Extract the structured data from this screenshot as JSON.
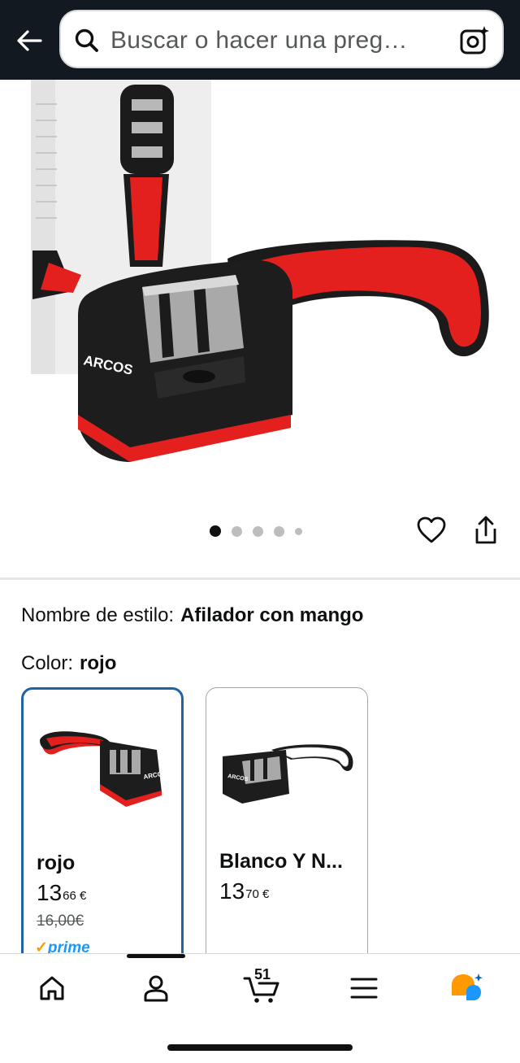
{
  "search": {
    "placeholder": "Buscar o hacer una preg…"
  },
  "product": {
    "brand_mark": "ARCOS",
    "image_index": 1,
    "image_count": 5
  },
  "selections": {
    "style_label": "Nombre de estilo:",
    "style_value": "Afilador con mango",
    "color_label": "Color:",
    "color_value": "rojo"
  },
  "swatches": [
    {
      "name": "rojo",
      "price_whole": "13",
      "price_frac": "66 €",
      "old_price": "16,00€",
      "prime": "prime",
      "selected": true,
      "accent": "#d71f1f"
    },
    {
      "name": "Blanco Y N...",
      "price_whole": "13",
      "price_frac": "70 €",
      "selected": false,
      "accent": "#ffffff"
    }
  ],
  "nav": {
    "items": [
      "home-icon",
      "account-icon",
      "cart-icon",
      "menu-icon",
      "rufus-icon"
    ],
    "cart_count": "51"
  },
  "colors": {
    "header_bg": "#131921",
    "selected_border": "#2162a1",
    "prime_blue": "#1a98ff",
    "rufus_orange": "#ff9900",
    "rufus_blue": "#1a98ff"
  }
}
